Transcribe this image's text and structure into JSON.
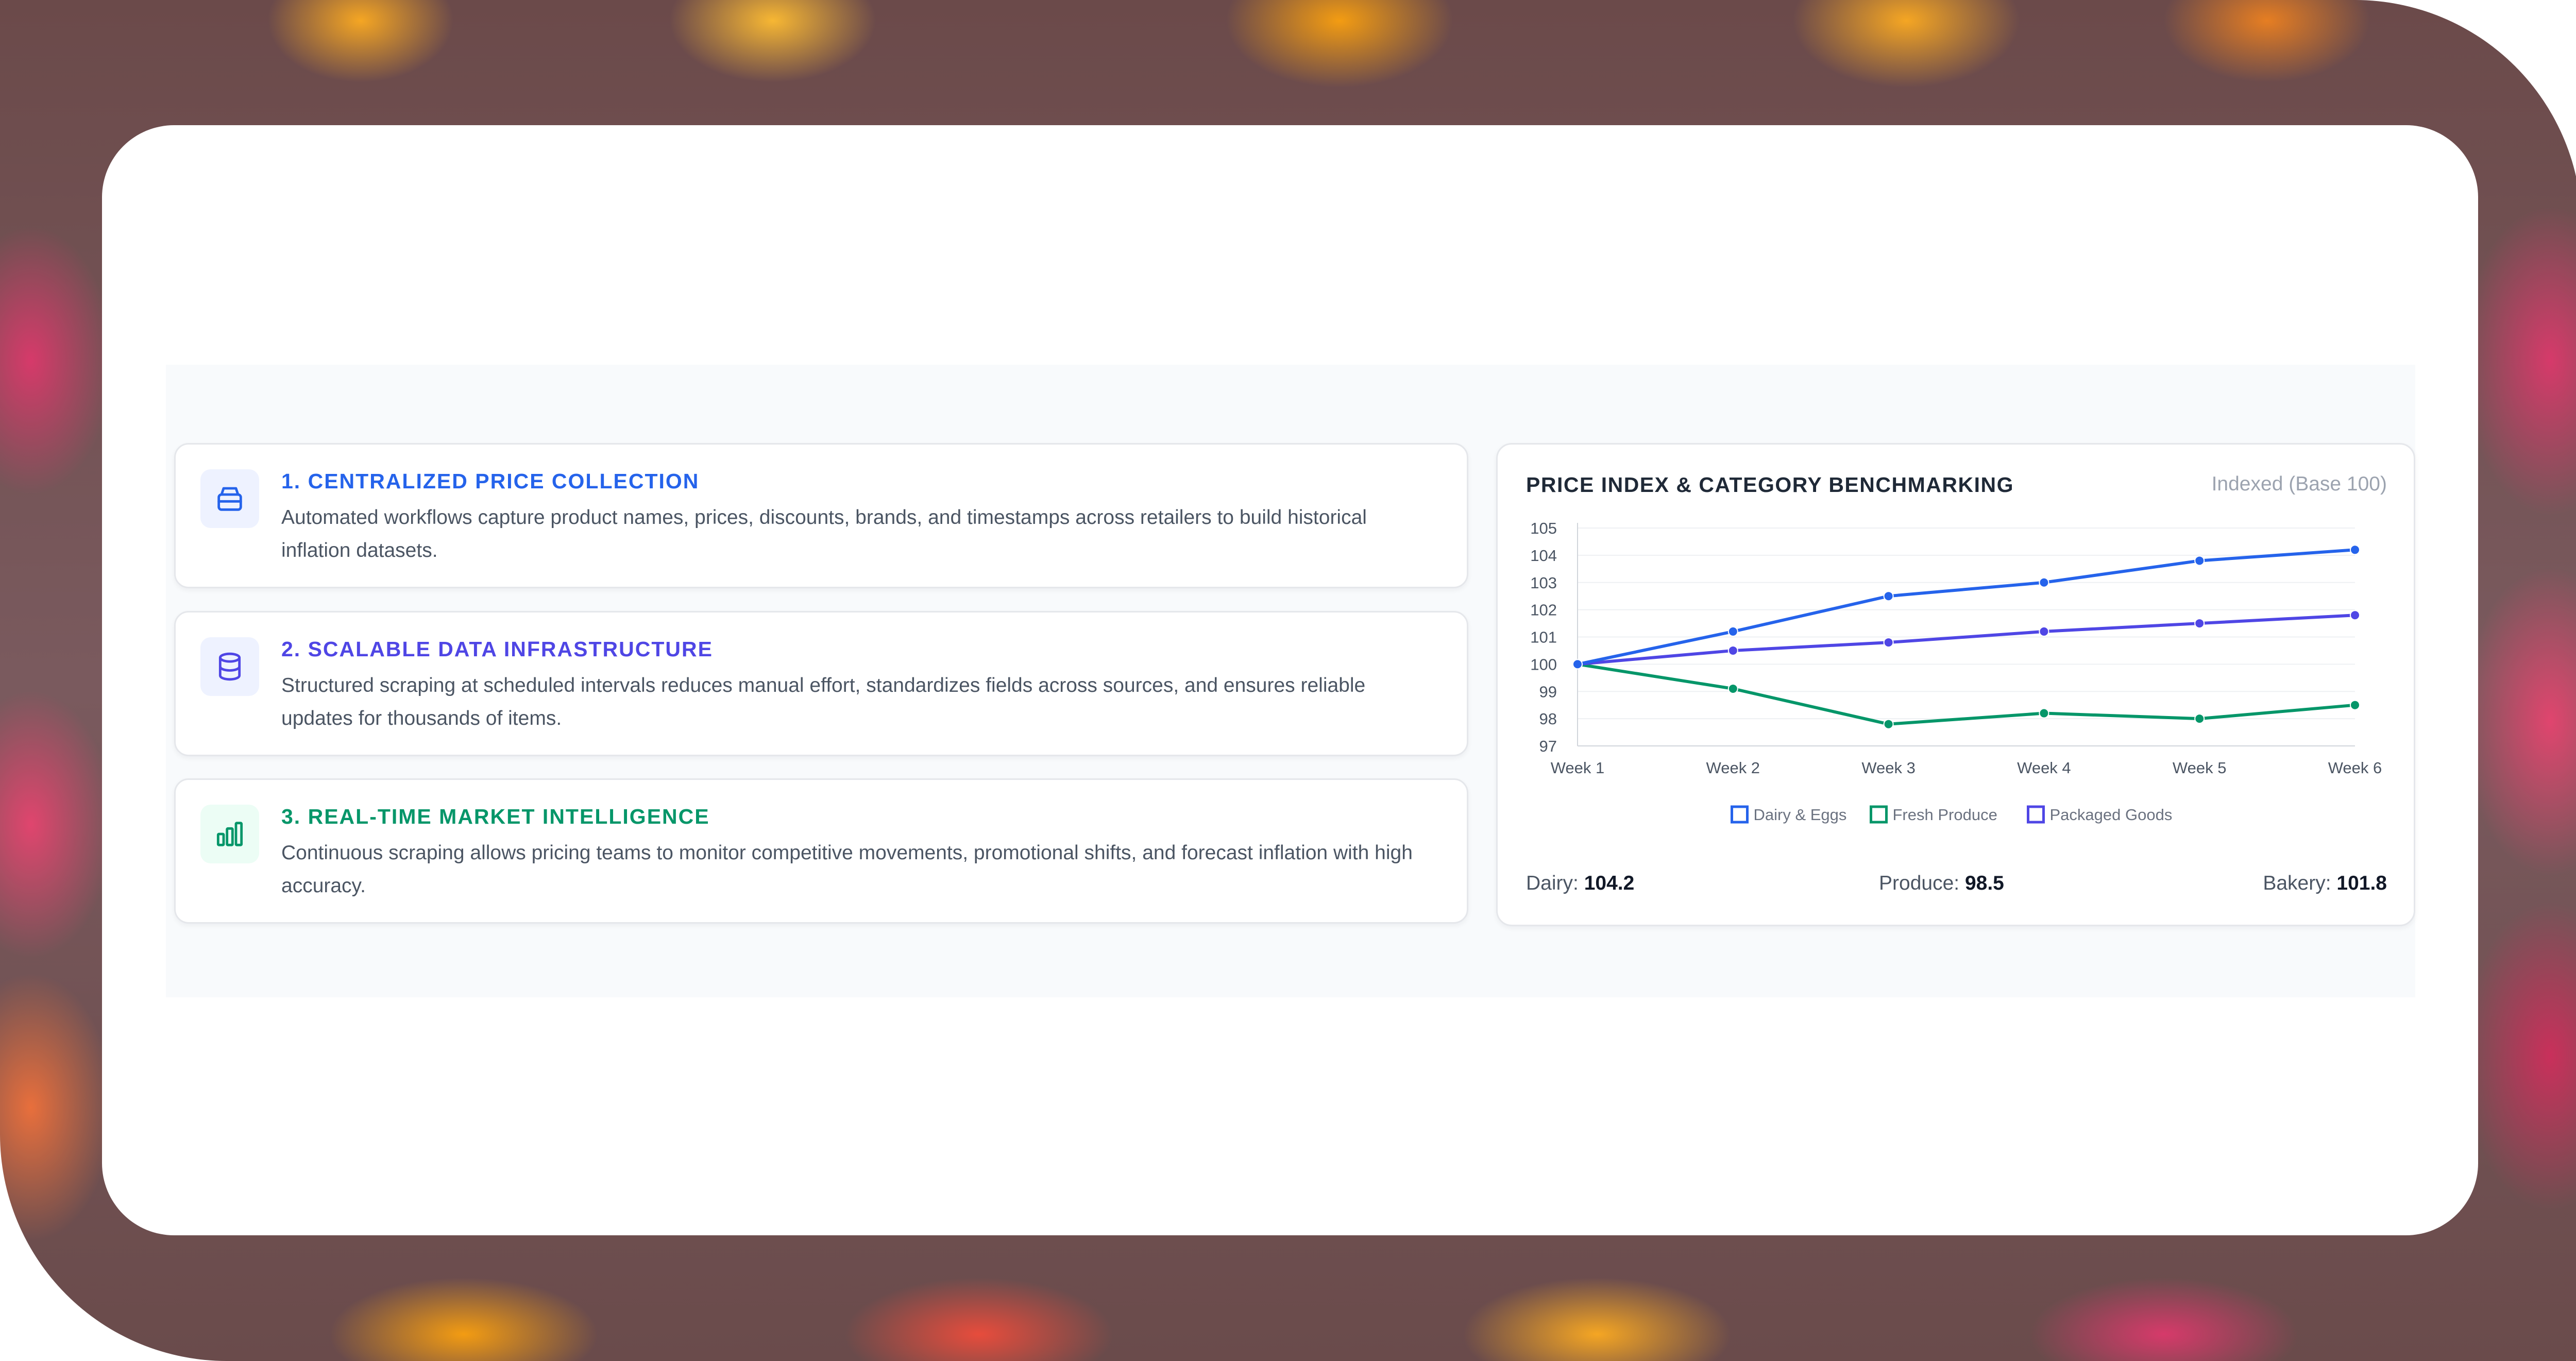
{
  "features": [
    {
      "title": "1. CENTRALIZED PRICE COLLECTION",
      "description": "Automated workflows capture product names, prices, discounts, brands, and timestamps across retailers to build historical inflation datasets.",
      "icon": "archive-box-icon",
      "color": "#2563eb",
      "icon_bg": "#eef2ff"
    },
    {
      "title": "2. SCALABLE DATA INFRASTRUCTURE",
      "description": "Structured scraping at scheduled intervals reduces manual effort, standardizes fields across sources, and ensures reliable updates for thousands of items.",
      "icon": "database-icon",
      "color": "#4f46e5",
      "icon_bg": "#eef2ff"
    },
    {
      "title": "3. REAL-TIME MARKET INTELLIGENCE",
      "description": "Continuous scraping allows pricing teams to monitor competitive movements, promotional shifts, and forecast inflation with high accuracy.",
      "icon": "bar-chart-icon",
      "color": "#059669",
      "icon_bg": "#ecfdf5"
    }
  ],
  "chart_panel": {
    "title": "PRICE INDEX & CATEGORY BENCHMARKING",
    "note": "Indexed (Base 100)",
    "stats": [
      {
        "label": "Dairy:",
        "value": "104.2"
      },
      {
        "label": "Produce:",
        "value": "98.5"
      },
      {
        "label": "Bakery:",
        "value": "101.8"
      }
    ]
  },
  "chart_data": {
    "type": "line",
    "x": [
      "Week 1",
      "Week 2",
      "Week 3",
      "Week 4",
      "Week 5",
      "Week 6"
    ],
    "ylim": [
      97,
      105
    ],
    "yticks": [
      97,
      98,
      99,
      100,
      101,
      102,
      103,
      104,
      105
    ],
    "grid": true,
    "legend_placement": "bottom",
    "series": [
      {
        "name": "Dairy & Eggs",
        "color": "#2563eb",
        "values": [
          100,
          101.2,
          102.5,
          103.0,
          103.8,
          104.2
        ]
      },
      {
        "name": "Fresh Produce",
        "color": "#059669",
        "values": [
          100,
          99.1,
          97.8,
          98.2,
          98.0,
          98.5
        ]
      },
      {
        "name": "Packaged Goods",
        "color": "#4f46e5",
        "values": [
          100,
          100.5,
          100.8,
          101.2,
          101.5,
          101.8
        ]
      }
    ]
  }
}
